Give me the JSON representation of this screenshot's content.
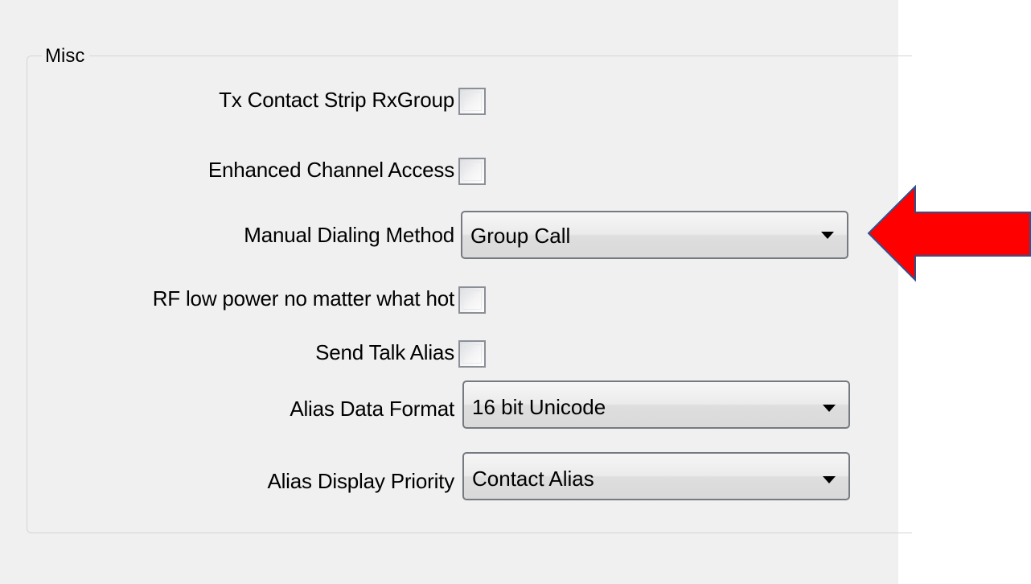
{
  "group": {
    "title": "Misc"
  },
  "fields": {
    "tx_contact_strip": {
      "label": "Tx Contact Strip RxGroup",
      "checked": false
    },
    "enhanced_channel_access": {
      "label": "Enhanced Channel Access",
      "checked": false
    },
    "manual_dialing_method": {
      "label": "Manual Dialing Method",
      "value": "Group Call"
    },
    "rf_low_power": {
      "label": "RF low power no matter what hot",
      "checked": false
    },
    "send_talk_alias": {
      "label": "Send Talk Alias",
      "checked": false
    },
    "alias_data_format": {
      "label": "Alias Data Format",
      "value": "16 bit Unicode"
    },
    "alias_display_priority": {
      "label": "Alias Display Priority",
      "value": "Contact Alias"
    }
  },
  "annotation": {
    "arrow_color": "#ff0000",
    "arrow_outline": "#2f528f",
    "arrow_icon": "left-arrow-icon"
  }
}
